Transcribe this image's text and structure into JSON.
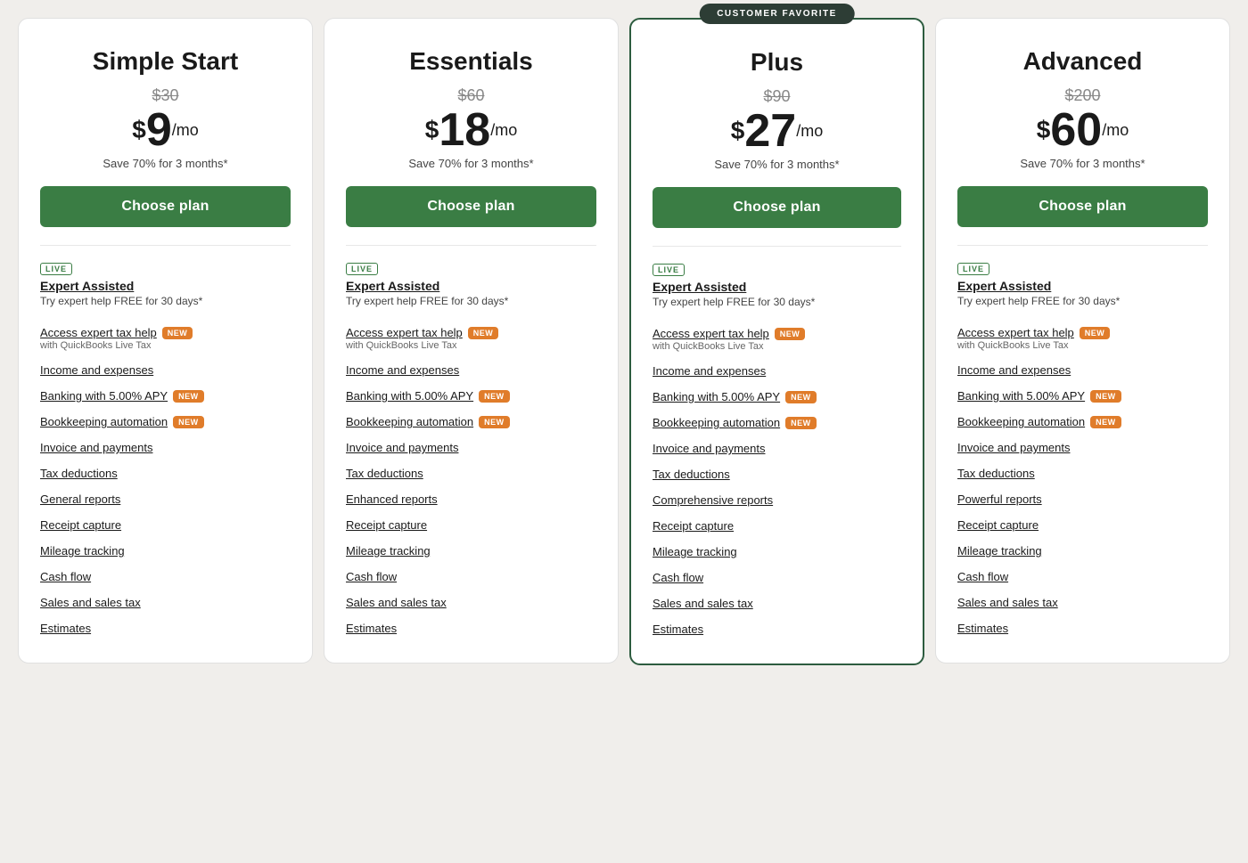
{
  "page": {
    "background": "#f0eeeb"
  },
  "plans": [
    {
      "id": "simple-start",
      "name": "Simple Start",
      "featured": false,
      "original_price": "$30",
      "current_price_dollar": "$",
      "current_price_amount": "9",
      "current_price_suffix": "/mo",
      "save_text": "Save 70% for 3 months*",
      "choose_btn": "Choose plan",
      "live_badge": "LIVE",
      "expert_title": "Expert Assisted",
      "expert_sub": "Try expert help FREE for 30 days*",
      "features": [
        {
          "text": "Access expert tax help",
          "badge": "NEW",
          "sub": "with QuickBooks Live Tax"
        },
        {
          "text": "Income and expenses"
        },
        {
          "text": "Banking with 5.00% APY",
          "badge": "NEW"
        },
        {
          "text": "Bookkeeping automation",
          "badge": "NEW"
        },
        {
          "text": "Invoice and payments"
        },
        {
          "text": "Tax deductions"
        },
        {
          "text": "General reports"
        },
        {
          "text": "Receipt capture"
        },
        {
          "text": "Mileage tracking"
        },
        {
          "text": "Cash flow"
        },
        {
          "text": "Sales and sales tax"
        },
        {
          "text": "Estimates"
        }
      ]
    },
    {
      "id": "essentials",
      "name": "Essentials",
      "featured": false,
      "original_price": "$60",
      "current_price_dollar": "$",
      "current_price_amount": "18",
      "current_price_suffix": "/mo",
      "save_text": "Save 70% for 3 months*",
      "choose_btn": "Choose plan",
      "live_badge": "LIVE",
      "expert_title": "Expert Assisted",
      "expert_sub": "Try expert help FREE for 30 days*",
      "features": [
        {
          "text": "Access expert tax help",
          "badge": "NEW",
          "sub": "with QuickBooks Live Tax"
        },
        {
          "text": "Income and expenses"
        },
        {
          "text": "Banking with 5.00% APY",
          "badge": "NEW"
        },
        {
          "text": "Bookkeeping automation",
          "badge": "NEW"
        },
        {
          "text": "Invoice and payments"
        },
        {
          "text": "Tax deductions"
        },
        {
          "text": "Enhanced reports"
        },
        {
          "text": "Receipt capture"
        },
        {
          "text": "Mileage tracking"
        },
        {
          "text": "Cash flow"
        },
        {
          "text": "Sales and sales tax"
        },
        {
          "text": "Estimates"
        }
      ]
    },
    {
      "id": "plus",
      "name": "Plus",
      "featured": true,
      "customer_favorite_badge": "CUSTOMER FAVORITE",
      "original_price": "$90",
      "current_price_dollar": "$",
      "current_price_amount": "27",
      "current_price_suffix": "/mo",
      "save_text": "Save 70% for 3 months*",
      "choose_btn": "Choose plan",
      "live_badge": "LIVE",
      "expert_title": "Expert Assisted",
      "expert_sub": "Try expert help FREE for 30 days*",
      "features": [
        {
          "text": "Access expert tax help",
          "badge": "NEW",
          "sub": "with QuickBooks Live Tax"
        },
        {
          "text": "Income and expenses"
        },
        {
          "text": "Banking with 5.00% APY",
          "badge": "NEW"
        },
        {
          "text": "Bookkeeping automation",
          "badge": "NEW"
        },
        {
          "text": "Invoice and payments"
        },
        {
          "text": "Tax deductions"
        },
        {
          "text": "Comprehensive reports"
        },
        {
          "text": "Receipt capture"
        },
        {
          "text": "Mileage tracking"
        },
        {
          "text": "Cash flow"
        },
        {
          "text": "Sales and sales tax"
        },
        {
          "text": "Estimates"
        }
      ]
    },
    {
      "id": "advanced",
      "name": "Advanced",
      "featured": false,
      "original_price": "$200",
      "current_price_dollar": "$",
      "current_price_amount": "60",
      "current_price_suffix": "/mo",
      "save_text": "Save 70% for 3 months*",
      "choose_btn": "Choose plan",
      "live_badge": "LIVE",
      "expert_title": "Expert Assisted",
      "expert_sub": "Try expert help FREE for 30 days*",
      "features": [
        {
          "text": "Access expert tax help",
          "badge": "NEW",
          "sub": "with QuickBooks Live Tax"
        },
        {
          "text": "Income and expenses"
        },
        {
          "text": "Banking with 5.00% APY",
          "badge": "NEW"
        },
        {
          "text": "Bookkeeping automation",
          "badge": "NEW"
        },
        {
          "text": "Invoice and payments"
        },
        {
          "text": "Tax deductions"
        },
        {
          "text": "Powerful reports"
        },
        {
          "text": "Receipt capture"
        },
        {
          "text": "Mileage tracking"
        },
        {
          "text": "Cash flow"
        },
        {
          "text": "Sales and sales tax"
        },
        {
          "text": "Estimates"
        }
      ]
    }
  ]
}
